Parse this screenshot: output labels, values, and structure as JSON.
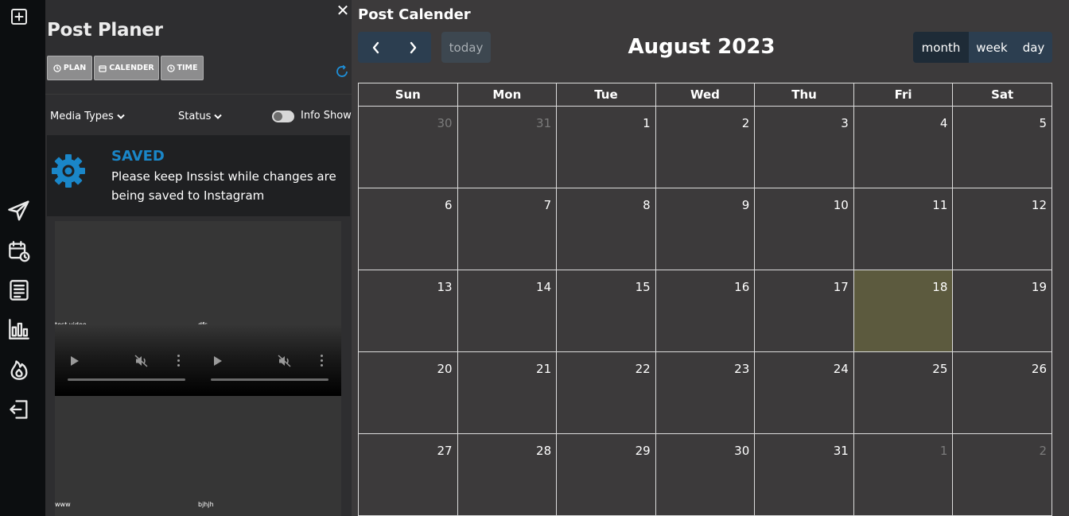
{
  "rail": {
    "icons": [
      "add-icon",
      "send-icon",
      "calendar-clock-icon",
      "document-icon",
      "analytics-icon",
      "fire-icon",
      "logout-icon"
    ]
  },
  "planner": {
    "title": "Post Planer",
    "close_label": "✕",
    "tabs": [
      {
        "label": "PLAN",
        "icon": "clock-icon"
      },
      {
        "label": "CALENDER",
        "icon": "calendar-icon"
      },
      {
        "label": "TIME",
        "icon": "clock-icon"
      }
    ],
    "filters": {
      "media_types": "Media Types",
      "status": "Status"
    },
    "toggle_label": "Info Show",
    "saved": {
      "title": "SAVED",
      "message": "Please keep Inssist while changes are being saved to Instagram"
    },
    "media": [
      {
        "caption": "test video"
      },
      {
        "caption": "dfs"
      },
      {
        "caption": "www"
      },
      {
        "caption": "bjhjh"
      }
    ]
  },
  "calendar": {
    "page_title": "Post Calender",
    "today_label": "today",
    "month_title": "August 2023",
    "views": [
      "month",
      "week",
      "day"
    ],
    "active_view": "month",
    "weekdays": [
      "Sun",
      "Mon",
      "Tue",
      "Wed",
      "Thu",
      "Fri",
      "Sat"
    ],
    "weeks": [
      [
        {
          "d": "30",
          "o": true
        },
        {
          "d": "31",
          "o": true
        },
        {
          "d": "1"
        },
        {
          "d": "2"
        },
        {
          "d": "3"
        },
        {
          "d": "4"
        },
        {
          "d": "5"
        }
      ],
      [
        {
          "d": "6"
        },
        {
          "d": "7"
        },
        {
          "d": "8"
        },
        {
          "d": "9"
        },
        {
          "d": "10"
        },
        {
          "d": "11"
        },
        {
          "d": "12"
        }
      ],
      [
        {
          "d": "13"
        },
        {
          "d": "14"
        },
        {
          "d": "15"
        },
        {
          "d": "16"
        },
        {
          "d": "17"
        },
        {
          "d": "18",
          "today": true
        },
        {
          "d": "19"
        }
      ],
      [
        {
          "d": "20"
        },
        {
          "d": "21"
        },
        {
          "d": "22"
        },
        {
          "d": "23"
        },
        {
          "d": "24"
        },
        {
          "d": "25"
        },
        {
          "d": "26"
        }
      ],
      [
        {
          "d": "27"
        },
        {
          "d": "28"
        },
        {
          "d": "29"
        },
        {
          "d": "30"
        },
        {
          "d": "31"
        },
        {
          "d": "1",
          "o": true
        },
        {
          "d": "2",
          "o": true
        }
      ]
    ],
    "colors": {
      "nav_bg": "#2c3e50",
      "today_highlight": "#5c5a3e",
      "saved_title": "#1a86c8"
    }
  }
}
